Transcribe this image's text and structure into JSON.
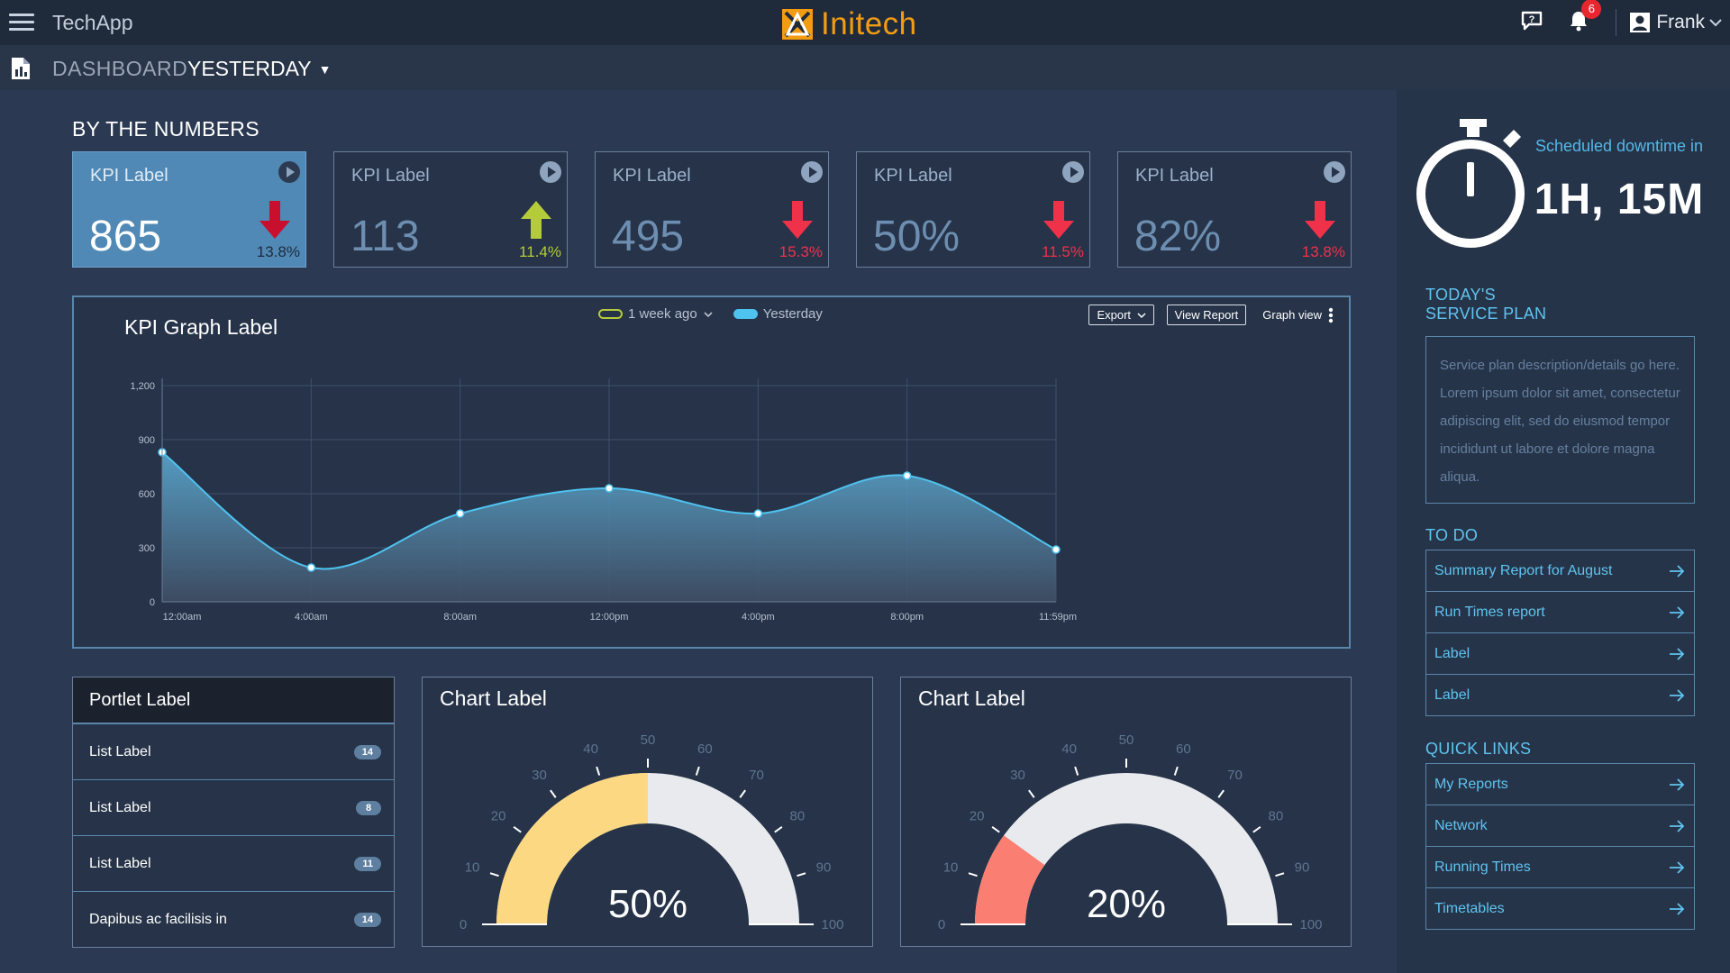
{
  "header": {
    "app_name": "TechApp",
    "brand": "Initech",
    "notification_count": "6",
    "user_name": "Frank",
    "brand_color": "#f39c12"
  },
  "subheader": {
    "dashboard_label": "DASHBOARD",
    "period": "YESTERDAY"
  },
  "kpi_section": {
    "title": "BY THE NUMBERS",
    "cards": [
      {
        "label": "KPI Label",
        "value": "865",
        "change": "13.8%",
        "direction": "down",
        "color": "#c8102e"
      },
      {
        "label": "KPI Label",
        "value": "113",
        "change": "11.4%",
        "direction": "up",
        "color": "#b5cc3a"
      },
      {
        "label": "KPI Label",
        "value": "495",
        "change": "15.3%",
        "direction": "down",
        "color": "#f0314a"
      },
      {
        "label": "KPI Label",
        "value": "50%",
        "change": "11.5%",
        "direction": "down",
        "color": "#f0314a"
      },
      {
        "label": "KPI Label",
        "value": "82%",
        "change": "13.8%",
        "direction": "down",
        "color": "#f0314a"
      }
    ]
  },
  "graph": {
    "title": "KPI Graph Label",
    "legend": [
      {
        "label": "1 week ago",
        "color": "#b5cc3a"
      },
      {
        "label": "Yesterday",
        "color": "#4fc3f0"
      }
    ],
    "actions": {
      "export": "Export",
      "view_report": "View Report",
      "graph_view": "Graph view"
    }
  },
  "chart_data": [
    {
      "type": "area",
      "title": "KPI Graph Label",
      "x": [
        "12:00am",
        "4:00am",
        "8:00am",
        "12:00pm",
        "4:00pm",
        "8:00pm",
        "11:59pm"
      ],
      "y_ticks": [
        "0",
        "300",
        "600",
        "900",
        "1,200"
      ],
      "ylim": [
        0,
        1200
      ],
      "grid": true,
      "series": [
        {
          "name": "Yesterday",
          "values": [
            830,
            190,
            490,
            630,
            490,
            700,
            290
          ],
          "color": "#4fc3f0"
        }
      ]
    },
    {
      "type": "gauge",
      "title": "Chart Label",
      "value": 50,
      "value_label": "50%",
      "ticks": [
        "0",
        "10",
        "20",
        "30",
        "40",
        "50",
        "60",
        "70",
        "80",
        "90",
        "100"
      ],
      "fill_color": "#fdd882"
    },
    {
      "type": "gauge",
      "title": "Chart Label",
      "value": 20,
      "value_label": "20%",
      "ticks": [
        "0",
        "10",
        "20",
        "30",
        "40",
        "50",
        "60",
        "70",
        "80",
        "90",
        "100"
      ],
      "fill_color": "#fa7f72"
    }
  ],
  "portlet": {
    "title": "Portlet Label",
    "items": [
      {
        "label": "List Label",
        "count": "14"
      },
      {
        "label": "List Label",
        "count": "8"
      },
      {
        "label": "List Label",
        "count": "11"
      },
      {
        "label": "Dapibus ac facilisis in",
        "count": "14"
      }
    ]
  },
  "sidebar": {
    "downtime_label": "Scheduled downtime in",
    "downtime_value": "1H, 15M",
    "service_plan_title": "TODAY'S SERVICE PLAN",
    "service_plan_text": "Service plan description/details go here. Lorem ipsum dolor sit amet, consectetur adipiscing elit, sed do eiusmod tempor incididunt ut labore et dolore magna aliqua.",
    "todo_title": "TO DO",
    "todo_items": [
      "Summary Report for August",
      "Run Times report",
      "Label",
      "Label"
    ],
    "quick_links_title": "QUICK LINKS",
    "quick_links": [
      "My Reports",
      "Network",
      "Running Times",
      "Timetables"
    ]
  }
}
